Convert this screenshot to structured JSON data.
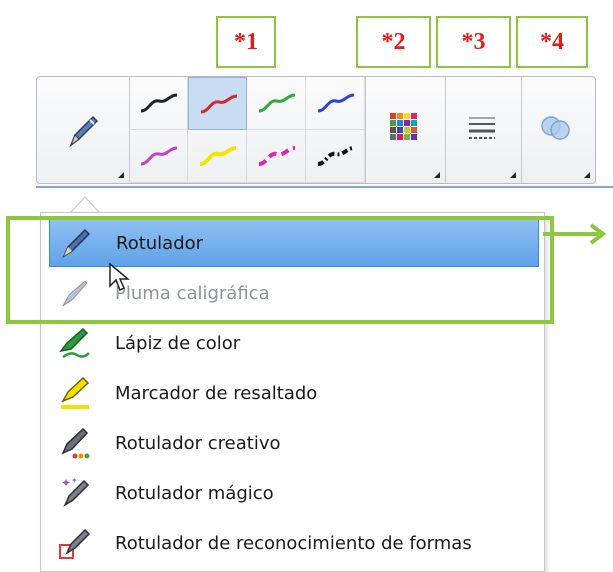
{
  "callouts": [
    "*1",
    "*2",
    "*3",
    "*4"
  ],
  "toolbar": {
    "pen_button": {
      "icon": "pen-icon"
    },
    "line_styles": [
      {
        "name": "black-line",
        "color": "#222222"
      },
      {
        "name": "red-line",
        "color": "#d9262b",
        "selected": true
      },
      {
        "name": "green-line",
        "color": "#2eaa3f"
      },
      {
        "name": "blue-line",
        "color": "#2f3fd9"
      },
      {
        "name": "magenta-line",
        "color": "#c83ec8"
      },
      {
        "name": "yellow-line",
        "color": "#f3e600"
      },
      {
        "name": "dashed-magenta-line",
        "color": "#e020c0"
      },
      {
        "name": "dotted-black-line",
        "color": "#111111"
      }
    ],
    "color_palette_button": {
      "icon": "color-palette-icon"
    },
    "line_properties_button": {
      "icon": "line-properties-icon"
    },
    "fill_effects_button": {
      "icon": "fill-effects-icon"
    }
  },
  "menu": {
    "items": [
      {
        "label": "Rotulador",
        "icon": "marker-pen-icon",
        "highlighted": true
      },
      {
        "label": "Pluma caligráfica",
        "icon": "calligraphy-pen-icon",
        "disabled": true
      },
      {
        "label": "Lápiz de color",
        "icon": "crayon-icon"
      },
      {
        "label": "Marcador de resaltado",
        "icon": "highlighter-icon"
      },
      {
        "label": "Rotulador creativo",
        "icon": "creative-pen-icon"
      },
      {
        "label": "Rotulador mágico",
        "icon": "magic-pen-icon"
      },
      {
        "label": "Rotulador de reconocimiento de formas",
        "icon": "shape-recognition-pen-icon"
      }
    ]
  },
  "colors": {
    "annotation_green": "#8dc63f",
    "callout_red": "#e31b1b",
    "selection_blue": "#5fa2e8"
  }
}
